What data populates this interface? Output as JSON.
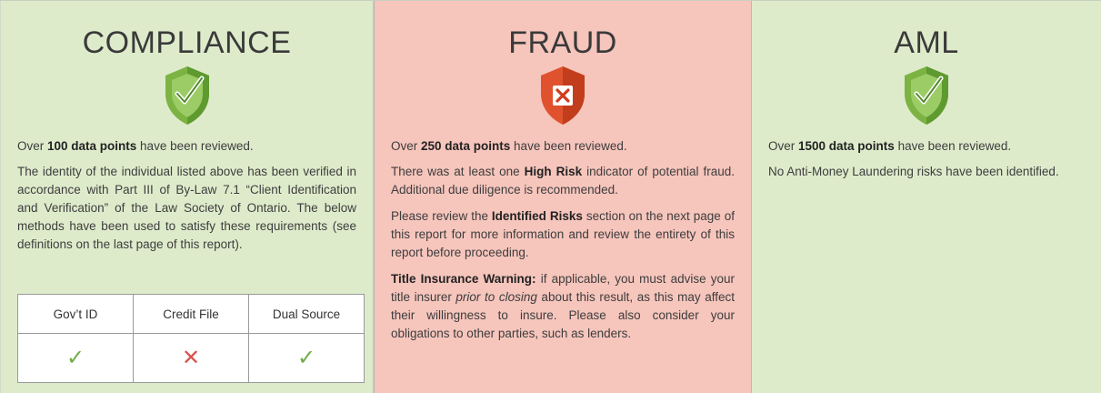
{
  "colors": {
    "pass_bg": "#deebcb",
    "fail_bg": "#f6c5bc",
    "pass_accent": "#70ad47",
    "fail_accent": "#d9534f"
  },
  "compliance": {
    "title": "COMPLIANCE",
    "status_icon": "shield-check-icon",
    "summary_pre": "Over ",
    "summary_bold": "100 data points",
    "summary_post": " have been reviewed.",
    "body": "The identity of the individual listed above has been verified in accordance with Part III of By-Law 7.1 “Client Identification and Verification” of the Law Society of Ontario. The below methods have been used to satisfy these requirements (see definitions on the last page of this report).",
    "methods": [
      {
        "label": "Gov’t ID",
        "result": "✓",
        "status": "pass"
      },
      {
        "label": "Credit File",
        "result": "✕",
        "status": "fail"
      },
      {
        "label": "Dual Source",
        "result": "✓",
        "status": "pass"
      }
    ]
  },
  "fraud": {
    "title": "FRAUD",
    "status_icon": "shield-x-icon",
    "summary_pre": "Over ",
    "summary_bold": "250 data points",
    "summary_post": " have been reviewed.",
    "p1_pre": "There was at least one ",
    "p1_bold": "High Risk",
    "p1_post": " indicator of potential fraud. Additional due diligence is recommended.",
    "p2_pre": "Please review the ",
    "p2_bold": "Identified Risks",
    "p2_post": " section on the next page of this report for more information and review the entirety of this report before proceeding.",
    "p3_bold": "Title Insurance Warning:",
    "p3_pre": " if applicable, you must advise your title insurer ",
    "p3_italic": "prior to closing",
    "p3_post": " about this result, as this may affect their willingness to insure. Please also consider your obligations to other parties, such as lenders."
  },
  "aml": {
    "title": "AML",
    "status_icon": "shield-check-icon",
    "summary_pre": "Over ",
    "summary_bold": "1500 data points",
    "summary_post": " have been reviewed.",
    "body": "No Anti-Money Laundering risks have been identified."
  }
}
